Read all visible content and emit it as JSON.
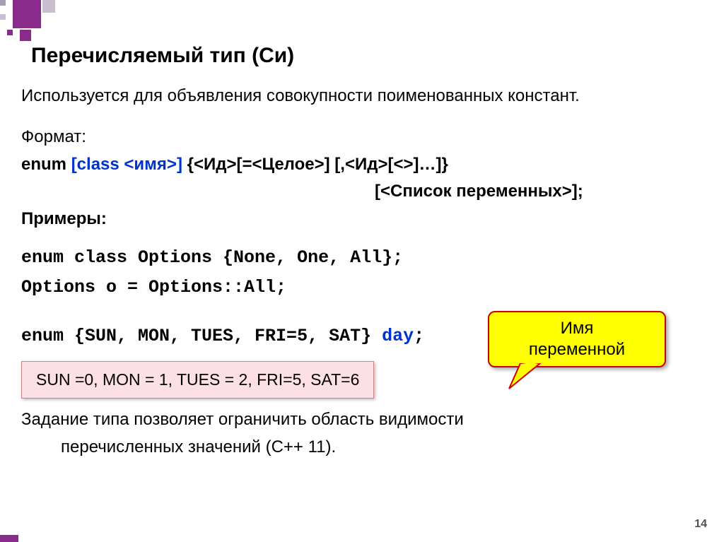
{
  "title": "Перечисляемый тип (Си)",
  "intro": "Используется для объявления совокупности поименованных констант.",
  "format_label": "Формат:",
  "format_line1_pre": "enum ",
  "format_line1_hl": "[class <имя>]",
  "format_line1_post": " {<Ид>[=<Целое>] [,<Ид>[<>]…]}",
  "format_line2": "[<Список переменных>];",
  "examples_label": "Примеры:",
  "code1": "enum class Options {None, One, All};",
  "code2": "Options o = Options::All;",
  "code3_pre": "enum {SUN, MON, TUES, FRI=5, SAT} ",
  "code3_hl": "day",
  "code3_post": ";",
  "pinkbox": "SUN =0, MON = 1, TUES = 2, FRI=5, SAT=6",
  "callout_l1": "Имя",
  "callout_l2": "переменной",
  "note_l1": "Задание типа позволяет ограничить область видимости",
  "note_l2": "перечисленных значений (С++ 11).",
  "pagenum": "14"
}
